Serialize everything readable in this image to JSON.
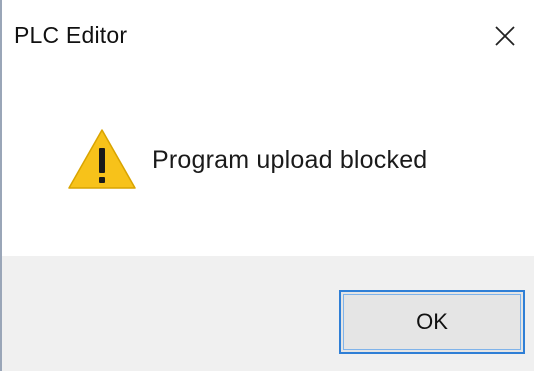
{
  "window": {
    "title": "PLC Editor",
    "close_icon": "close-icon"
  },
  "message": {
    "icon": "warning-icon",
    "text": "Program upload blocked"
  },
  "buttons": {
    "ok_label": "OK"
  },
  "colors": {
    "warning_yellow": "#f7c21a",
    "focus_border": "#2f7fd6",
    "footer_bg": "#f0f0f0"
  }
}
